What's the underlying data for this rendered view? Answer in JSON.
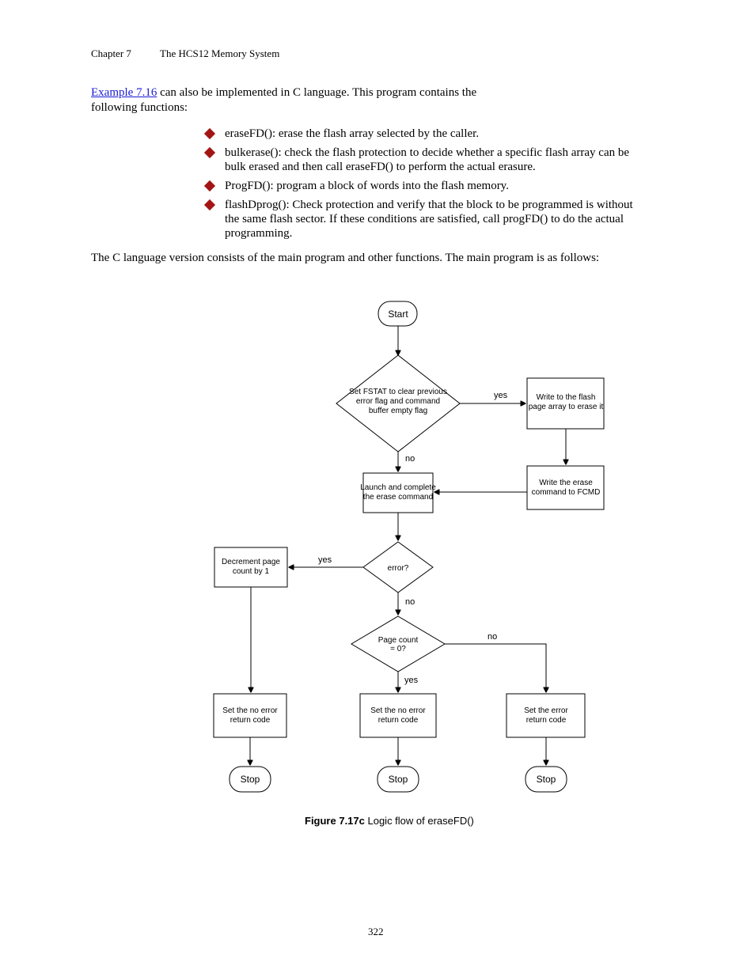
{
  "header": {
    "chapter": "Chapter 7",
    "title": "The HCS12 Memory System"
  },
  "intro": {
    "link_text": "Example 7.16",
    "tail_text": " can also be implemented in C language. This program contains the",
    "line2": "following functions:"
  },
  "bullets": [
    "eraseFD(): erase the flash array selected by the caller.",
    "bulkerase(): check the flash protection to decide whether a specific flash array can be bulk erased and then call eraseFD() to perform the actual erasure.",
    "ProgFD(): program a block of words into the flash memory.",
    "flashDprog(): Check protection and verify that the block to be programmed is without the same flash sector. If these conditions are satisfied, call progFD() to do the actual programming."
  ],
  "body_para": "The C language version consists of the main program and other functions. The main program is as follows:",
  "flowchart": {
    "start": "Start",
    "d1": {
      "line1": "Set FSTAT to clear previous",
      "line2": "error flag and command",
      "line3": "buffer empty flag"
    },
    "d1_yes": "yes",
    "d1_no": "no",
    "r_top": {
      "line1": "Write to the flash",
      "line2": "page array to erase it"
    },
    "r_mid": {
      "line1": "Write the erase",
      "line2": "command to FCMD"
    },
    "p_center": {
      "line1": "Launch and complete",
      "line2": "the erase command"
    },
    "d2": {
      "label": "error?"
    },
    "d2_yes": "yes",
    "d2_no": "no",
    "l_box": {
      "line1": "Decrement page",
      "line2": "count by 1"
    },
    "d3": {
      "line1": "Page count",
      "line2": "= 0?"
    },
    "d3_yes": "yes",
    "d3_no": "no",
    "l_bot": {
      "line1": "Set the no error",
      "line2": "return code"
    },
    "c_bot": {
      "line1": "Set the no error",
      "line2": "return code"
    },
    "r_bot": {
      "line1": "Set the error",
      "line2": "return code"
    },
    "stop1": "Stop",
    "stop2": "Stop",
    "stop3": "Stop",
    "caption_bold": "Figure 7.17c",
    "caption_rest": " Logic flow of eraseFD()"
  },
  "footer": {
    "page": "322"
  }
}
